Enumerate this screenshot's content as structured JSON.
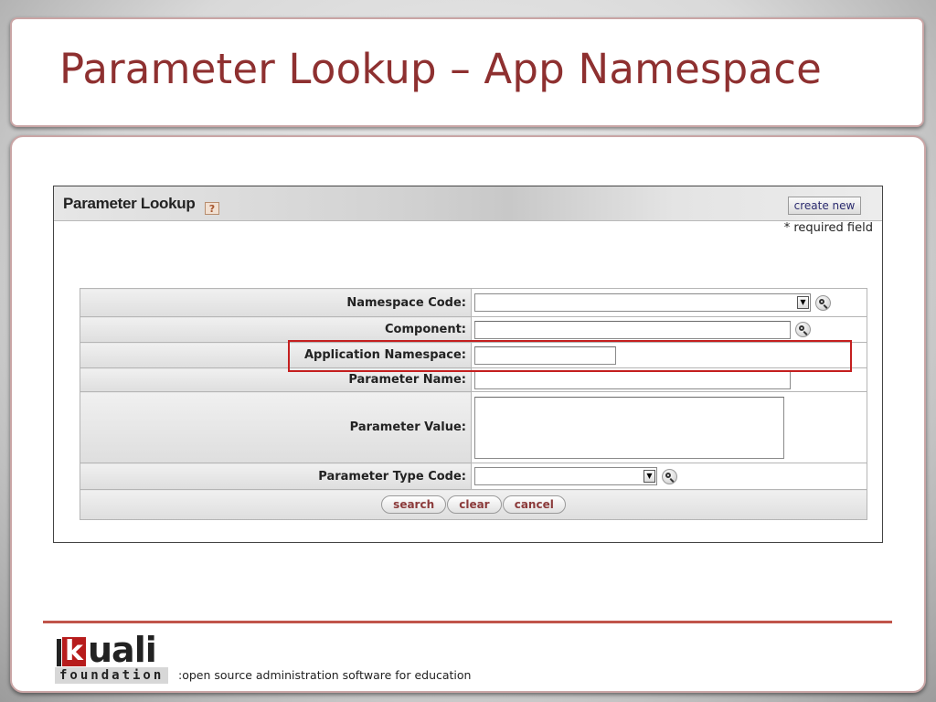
{
  "slide": {
    "title": "Parameter Lookup – App Namespace"
  },
  "panel": {
    "title": "Parameter Lookup",
    "help_icon": "?",
    "create_new_label": "create new",
    "required_note": "* required field"
  },
  "form": {
    "fields": [
      {
        "label": "Namespace Code:",
        "type": "select",
        "value": "",
        "lookup": true
      },
      {
        "label": "Component:",
        "type": "text",
        "value": "",
        "lookup": true
      },
      {
        "label": "Application Namespace:",
        "type": "text",
        "value": "",
        "lookup": false,
        "highlighted": true
      },
      {
        "label": "Parameter Name:",
        "type": "text",
        "value": "",
        "lookup": false
      },
      {
        "label": "Parameter Value:",
        "type": "textarea",
        "value": "",
        "lookup": false
      },
      {
        "label": "Parameter Type Code:",
        "type": "select",
        "value": "",
        "lookup": true
      }
    ],
    "buttons": {
      "search": "search",
      "clear": "clear",
      "cancel": "cancel"
    }
  },
  "icons": {
    "lookup": "magnifier-icon",
    "dropdown": "dropdown-arrow-icon",
    "help": "help-icon"
  },
  "footer": {
    "logo_word": "uali",
    "logo_k": "k",
    "logo_foundation": "foundation",
    "tagline": ":open source administration software for education"
  },
  "colors": {
    "title": "#8e3030",
    "highlight_border": "#c41f1f",
    "footer_line": "#c0544a",
    "logo_accent": "#b71c1c"
  }
}
